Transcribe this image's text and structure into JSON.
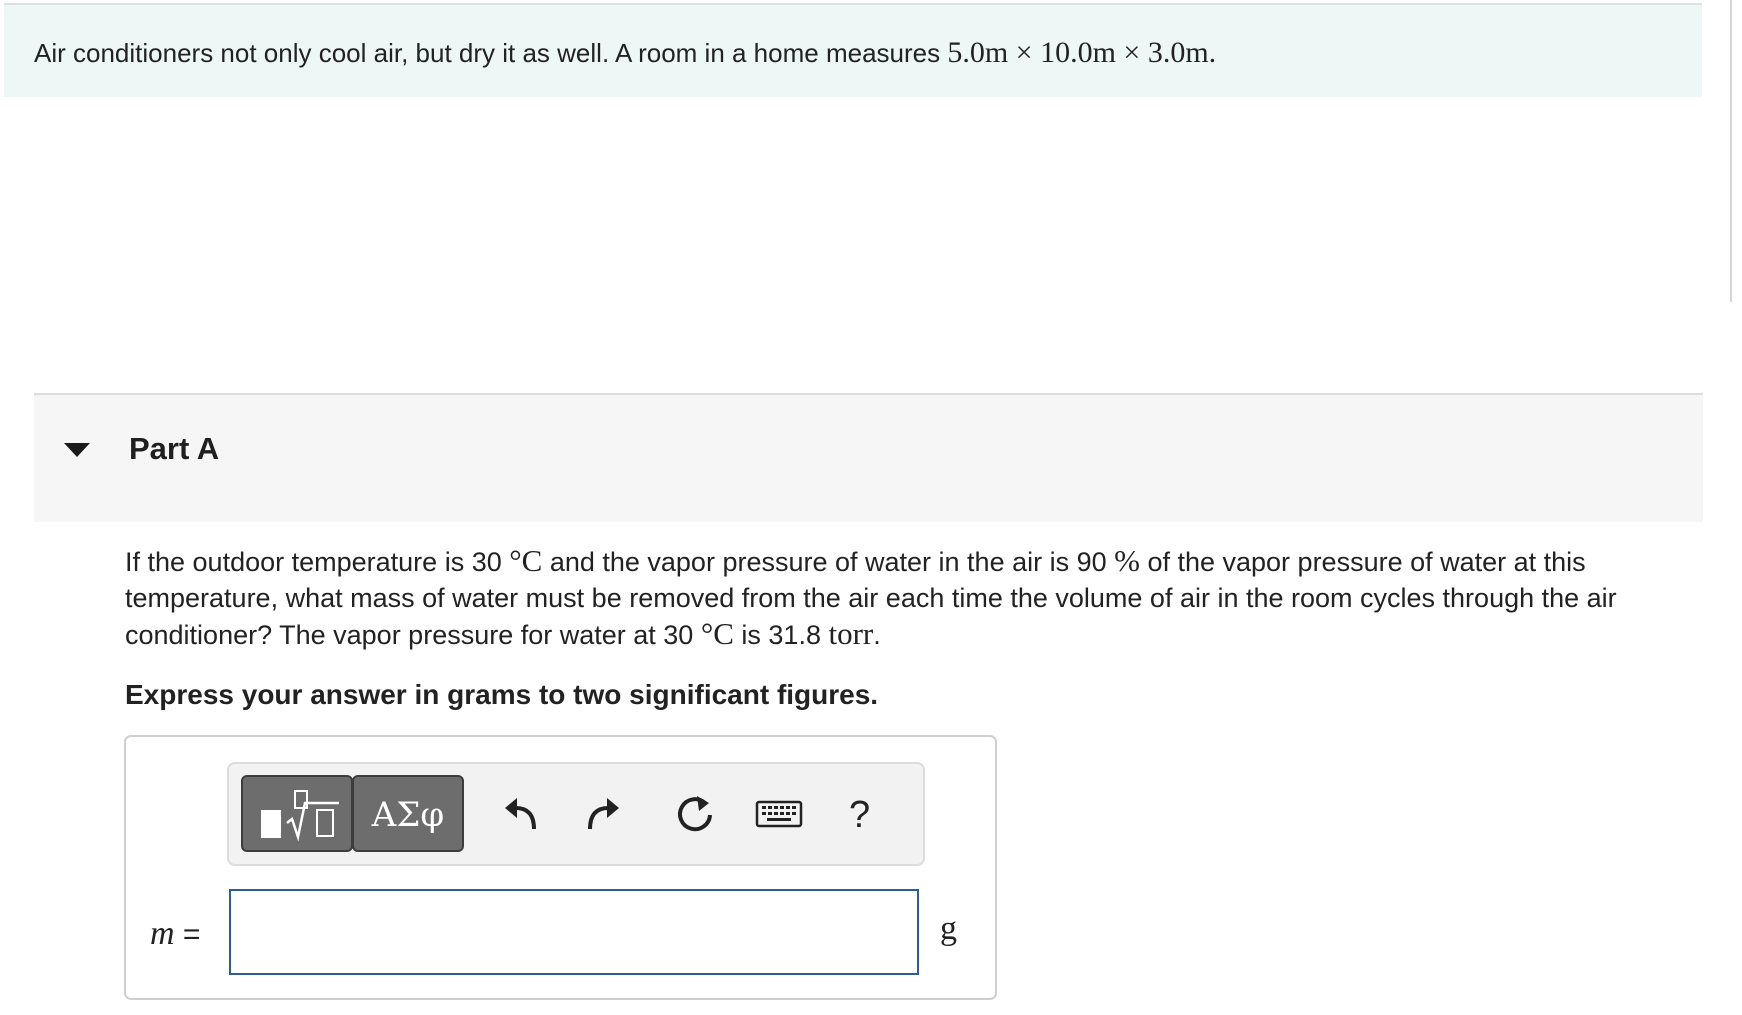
{
  "intro": {
    "text": "Air conditioners not only cool air, but dry it as well. A room in a home measures ",
    "dimensions": "5.0m × 10.0m × 3.0m."
  },
  "part": {
    "title": "Part A"
  },
  "question": {
    "t1": "If the outdoor temperature is 30 ",
    "m1": "°C",
    "t2": " and the vapor pressure of water in the air is 90 ",
    "m2": "%",
    "t3": " of the vapor pressure of water at this temperature, what mass of water must be removed from the air each time the volume of air in the room cycles through the air conditioner? The vapor pressure for water at 30 ",
    "m3": "°C",
    "t4": " is 31.8 ",
    "m4": "torr",
    "t5": "."
  },
  "instruction": "Express your answer in grams to two significant figures.",
  "answer": {
    "variable": "m",
    "equals": "=",
    "value": "",
    "unit": "g"
  },
  "toolbar": {
    "greek_label": "ΑΣφ",
    "help_label": "?",
    "icons": [
      "templates-icon",
      "greek-symbols-icon",
      "undo-icon",
      "redo-icon",
      "reset-icon",
      "keyboard-icon",
      "help-icon"
    ]
  },
  "colors": {
    "intro_bg": "#edf7f6",
    "part_bg": "#f6f6f6",
    "toolbar_button": "#6d6d6d",
    "input_border": "#2b5f8f"
  }
}
